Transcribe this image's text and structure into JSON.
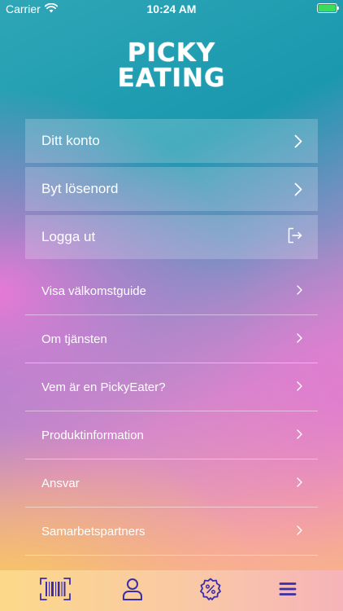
{
  "status_bar": {
    "carrier": "Carrier",
    "time": "10:24 AM"
  },
  "logo": {
    "line1": "PICKY",
    "line2": "EATING"
  },
  "account": {
    "items": [
      {
        "label": "Ditt konto",
        "icon": "chevron-right-icon"
      },
      {
        "label": "Byt lösenord",
        "icon": "chevron-right-icon"
      },
      {
        "label": "Logga ut",
        "icon": "logout-icon"
      }
    ]
  },
  "info": {
    "items": [
      {
        "label": "Visa välkomstguide"
      },
      {
        "label": "Om tjänsten"
      },
      {
        "label": "Vem är en PickyEater?"
      },
      {
        "label": "Produktinformation"
      },
      {
        "label": "Ansvar"
      },
      {
        "label": "Samarbetspartners"
      }
    ]
  },
  "tab_bar": {
    "tabs": [
      {
        "name": "barcode-scanner",
        "icon": "barcode-icon"
      },
      {
        "name": "profile",
        "icon": "user-icon"
      },
      {
        "name": "offers",
        "icon": "discount-badge-icon"
      },
      {
        "name": "menu",
        "icon": "hamburger-menu-icon"
      }
    ]
  },
  "colors": {
    "accent": "#3b2ea8",
    "battery": "#3ddc5a",
    "text": "#ffffff"
  }
}
